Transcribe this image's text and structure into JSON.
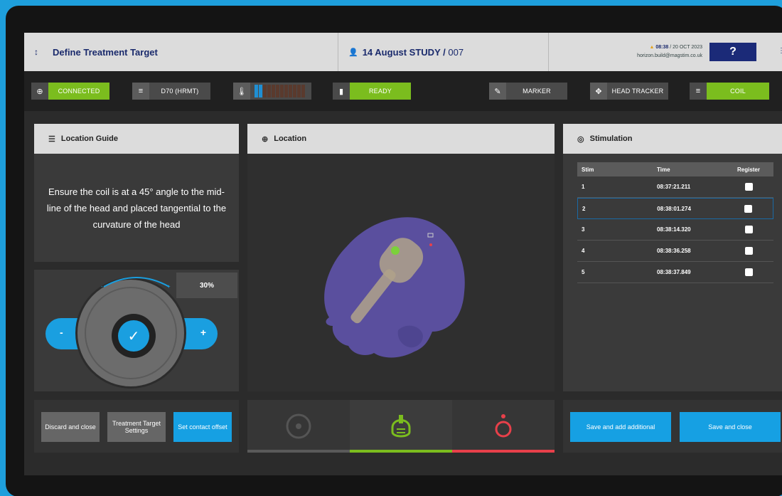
{
  "header": {
    "title": "Define Treatment Target",
    "study_name": "14 August STUDY /",
    "study_number": "007",
    "time": "08:38",
    "date": "/ 20 OCT 2023",
    "email": "horizon.build@magstim.co.uk",
    "help": "?"
  },
  "statusbar": {
    "connected": "CONNECTED",
    "coil_model": "D70 (HRMT)",
    "ready": "READY",
    "marker": "MARKER",
    "head_tracker": "HEAD TRACKER",
    "coil": "COIL",
    "temperature_level": 0.15
  },
  "guide": {
    "title": "Location Guide",
    "text": "Ensure the coil is at a 45° angle to the mid-line of the head and placed tangential to the curvature of the head"
  },
  "dial": {
    "percent": "30%",
    "minus": "-",
    "plus": "+",
    "check": "✓"
  },
  "buttons": {
    "discard": "Discard and close",
    "settings": "Treatment Target Settings",
    "contact": "Set contact offset"
  },
  "location": {
    "title": "Location"
  },
  "stimulation": {
    "title": "Stimulation",
    "headers": [
      "Stim",
      "Time",
      "Register"
    ],
    "rows": [
      {
        "stim": "1",
        "time": "08:37:21.211"
      },
      {
        "stim": "2",
        "time": "08:38:01.274"
      },
      {
        "stim": "3",
        "time": "08:38:14.320"
      },
      {
        "stim": "4",
        "time": "08:38:36.258"
      },
      {
        "stim": "5",
        "time": "08:38:37.849"
      }
    ],
    "save_add": "Save and add additional",
    "save_close": "Save and close"
  },
  "colors": {
    "accent": "#16a0e3",
    "green": "#7bbd1e",
    "red": "#e8404a",
    "head": "#5a4f9e"
  }
}
